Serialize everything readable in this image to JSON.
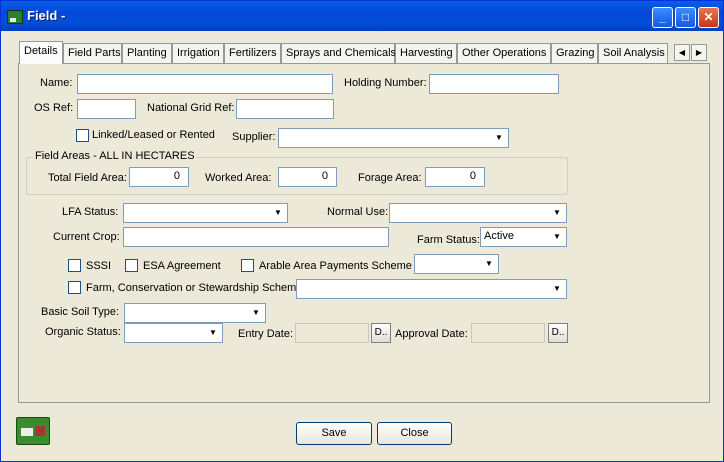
{
  "window": {
    "title": "Field -"
  },
  "tabs": [
    "Details",
    "Field Parts",
    "Planting",
    "Irrigation",
    "Fertilizers",
    "Sprays and Chemicals",
    "Harvesting",
    "Other Operations",
    "Grazing",
    "Soil Analysis"
  ],
  "form": {
    "name_label": "Name:",
    "name_value": "",
    "holding_label": "Holding Number:",
    "holding_value": "",
    "osref_label": "OS Ref:",
    "osref_value": "",
    "ngr_label": "National Grid Ref:",
    "ngr_value": "",
    "linked_label": "Linked/Leased or Rented",
    "supplier_label": "Supplier:",
    "supplier_value": "",
    "group_title": "Field Areas - ALL IN HECTARES",
    "total_area_label": "Total Field Area:",
    "total_area_value": "0",
    "worked_area_label": "Worked Area:",
    "worked_area_value": "0",
    "forage_area_label": "Forage Area:",
    "forage_area_value": "0",
    "lfa_label": "LFA Status:",
    "lfa_value": "",
    "normal_use_label": "Normal Use:",
    "normal_use_value": "",
    "current_crop_label": "Current Crop:",
    "current_crop_value": "",
    "farm_status_label": "Farm Status:",
    "farm_status_value": "Active",
    "sssi_label": "SSSI",
    "esa_label": "ESA Agreement",
    "arable_label": "Arable Area Payments Scheme",
    "arable_value": "",
    "farm_cons_label": "Farm, Conservation or Stewardship Scheme",
    "farm_cons_value": "",
    "soil_label": "Basic Soil Type:",
    "soil_value": "",
    "organic_label": "Organic Status:",
    "organic_value": "",
    "entry_label": "Entry Date:",
    "entry_value": "",
    "approval_label": "Approval Date:",
    "approval_value": "",
    "date_btn": "D.."
  },
  "buttons": {
    "save": "Save",
    "close": "Close"
  }
}
